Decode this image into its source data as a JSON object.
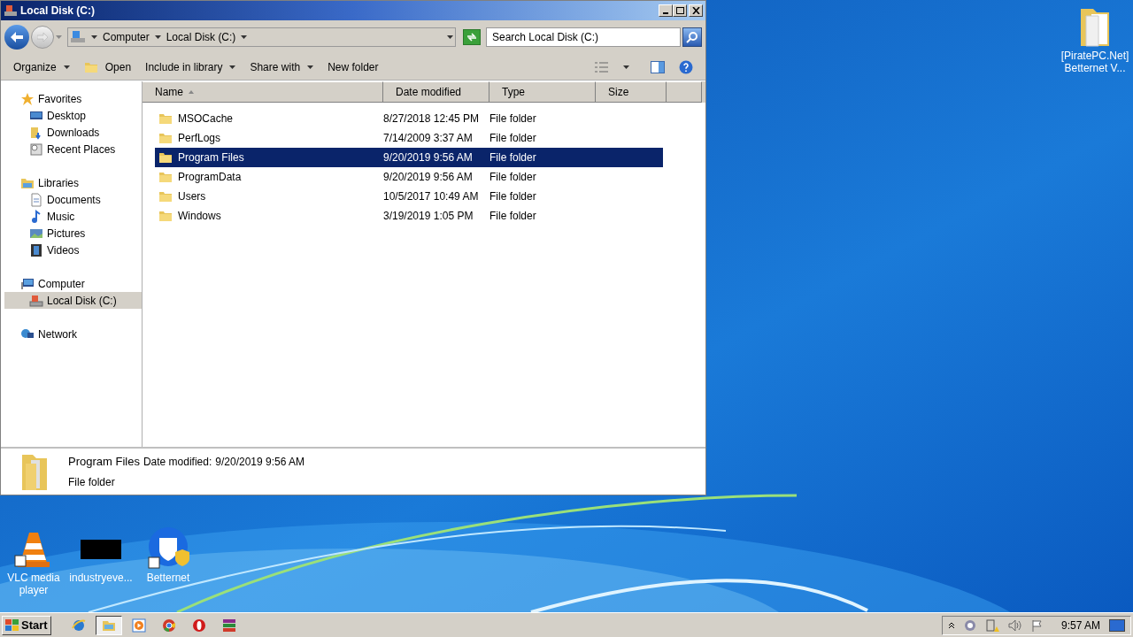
{
  "window": {
    "title": "Local Disk (C:)"
  },
  "address": {
    "crumbs": [
      "Computer",
      "Local Disk (C:)"
    ],
    "search_placeholder": "Search Local Disk (C:)"
  },
  "command_bar": [
    {
      "label": "Organize",
      "dropdown": true
    },
    {
      "label": "Open",
      "dropdown": false
    },
    {
      "label": "Include in library",
      "dropdown": true
    },
    {
      "label": "Share with",
      "dropdown": true
    },
    {
      "label": "New folder",
      "dropdown": false
    }
  ],
  "sidebar": [
    {
      "label": "Favorites",
      "children": [
        {
          "label": "Desktop",
          "selected": false
        },
        {
          "label": "Downloads",
          "selected": false
        },
        {
          "label": "Recent Places",
          "selected": false
        }
      ]
    },
    {
      "label": "Libraries",
      "children": [
        {
          "label": "Documents",
          "selected": false
        },
        {
          "label": "Music",
          "selected": false
        },
        {
          "label": "Pictures",
          "selected": false
        },
        {
          "label": "Videos",
          "selected": false
        }
      ]
    },
    {
      "label": "Computer",
      "children": [
        {
          "label": "Local Disk (C:)",
          "selected": true
        }
      ]
    },
    {
      "label": "Network"
    }
  ],
  "table": {
    "columns": [
      "Name",
      "Date modified",
      "Type",
      "Size"
    ],
    "rows": [
      {
        "name": "MSOCache",
        "date": "8/27/2018 12:45 PM",
        "type": "File folder",
        "selected": false
      },
      {
        "name": "PerfLogs",
        "date": "7/14/2009 3:37 AM",
        "type": "File folder",
        "selected": false
      },
      {
        "name": "Program Files",
        "date": "9/20/2019 9:56 AM",
        "type": "File folder",
        "selected": true
      },
      {
        "name": "ProgramData",
        "date": "9/20/2019 9:56 AM",
        "type": "File folder",
        "selected": false
      },
      {
        "name": "Users",
        "date": "10/5/2017 10:49 AM",
        "type": "File folder",
        "selected": false
      },
      {
        "name": "Windows",
        "date": "3/19/2019 1:05 PM",
        "type": "File folder",
        "selected": false
      }
    ]
  },
  "details": {
    "name": "Program Files",
    "date_label": "Date modified:",
    "date": "9/20/2019 9:56 AM",
    "type": "File folder"
  },
  "desktop_icons": [
    {
      "label": "VLC media player",
      "kind": "vlc"
    },
    {
      "label": "industryeve...",
      "kind": "black"
    },
    {
      "label": "Betternet",
      "kind": "shield"
    }
  ],
  "desktop_corner_icon": {
    "label": "[PiratePC.Net] Betternet V..."
  },
  "taskbar": {
    "start": "Start",
    "apps": [
      {
        "kind": "ie",
        "selected": false
      },
      {
        "kind": "explorer",
        "selected": true
      },
      {
        "kind": "media",
        "selected": false
      },
      {
        "kind": "chrome",
        "selected": false
      },
      {
        "kind": "opera",
        "selected": false
      },
      {
        "kind": "winrar",
        "selected": false
      }
    ],
    "clock": "9:57 AM"
  }
}
